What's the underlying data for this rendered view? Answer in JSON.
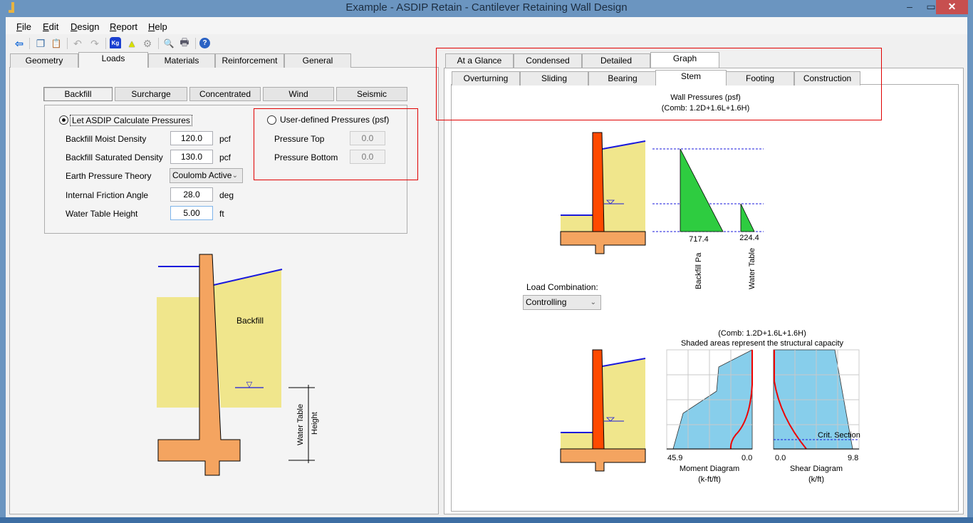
{
  "window": {
    "title": "Example - ASDIP Retain - Cantilever Retaining Wall Design",
    "minimize_glyph": "‒",
    "maximize_glyph": "▭",
    "close_glyph": "✕"
  },
  "menu": [
    {
      "label": "File",
      "accel": "F"
    },
    {
      "label": "Edit",
      "accel": "E"
    },
    {
      "label": "Design",
      "accel": "D"
    },
    {
      "label": "Report",
      "accel": "R"
    },
    {
      "label": "Help",
      "accel": "H"
    }
  ],
  "toolbar": [
    {
      "name": "pm-back-icon",
      "glyph": "⇦"
    },
    {
      "name": "copy-icon",
      "glyph": "❐"
    },
    {
      "name": "paste-icon",
      "glyph": "📋"
    },
    {
      "name": "undo-icon",
      "glyph": "↶"
    },
    {
      "name": "redo-icon",
      "glyph": "↷"
    },
    {
      "name": "weight-kg-icon",
      "glyph": "Kg"
    },
    {
      "name": "stack-icon",
      "glyph": "▲"
    },
    {
      "name": "gear-icon",
      "glyph": "⚙"
    },
    {
      "name": "zoom-icon",
      "glyph": "🔍"
    },
    {
      "name": "print-icon",
      "glyph": "🖶"
    },
    {
      "name": "help-icon",
      "glyph": "?"
    }
  ],
  "left_tabs": [
    "Geometry",
    "Loads",
    "Materials",
    "Reinforcement",
    "General"
  ],
  "left_active_tab": "Loads",
  "loads_subtabs": [
    "Backfill",
    "Surcharge",
    "Concentrated",
    "Wind",
    "Seismic"
  ],
  "loads_active_subtab": "Backfill",
  "backfill": {
    "calc_option_label": "Let ASDIP Calculate Pressures",
    "calc_option_selected": true,
    "user_option_label": "User-defined Pressures (psf)",
    "user_option_selected": false,
    "fields": [
      {
        "label": "Backfill Moist Density",
        "value": "120.0",
        "unit": "pcf"
      },
      {
        "label": "Backfill Saturated Density",
        "value": "130.0",
        "unit": "pcf"
      },
      {
        "label": "Earth Pressure Theory",
        "value": "Coulomb Active",
        "unit": ""
      },
      {
        "label": "Internal Friction Angle",
        "value": "28.0",
        "unit": "deg"
      },
      {
        "label": "Water Table Height",
        "value": "5.00",
        "unit": "ft"
      }
    ],
    "user_fields": [
      {
        "label": "Pressure Top",
        "value": "0.0"
      },
      {
        "label": "Pressure Bottom",
        "value": "0.0"
      }
    ]
  },
  "left_diagram": {
    "backfill_label": "Backfill",
    "dim_label_1": "Water Table",
    "dim_label_2": "Height",
    "water_symbol": "▽"
  },
  "right_tabs": [
    "At a Glance",
    "Condensed",
    "Detailed",
    "Graph"
  ],
  "right_active_tab": "Graph",
  "graph_subtabs": [
    "Overturning",
    "Sliding",
    "Bearing",
    "Stem",
    "Footing",
    "Construction"
  ],
  "graph_active_subtab": "Stem",
  "pressures": {
    "title": "Wall Pressures (psf)",
    "comb": "(Comb: 1.2D+1.6L+1.6H)",
    "backfill_value": "717.4",
    "water_value": "224.4",
    "backfill_label": "Backfill Pa",
    "water_label": "Water Table"
  },
  "load_combination": {
    "label": "Load Combination:",
    "value": "Controlling"
  },
  "capacity": {
    "comb": "(Comb: 1.2D+1.6L+1.6H)",
    "subtitle": "Shaded areas represent the structural capacity",
    "moment_left": "45.9",
    "moment_right": "0.0",
    "moment_title": "Moment Diagram",
    "moment_units": "(k-ft/ft)",
    "shear_left": "0.0",
    "shear_right": "9.8",
    "shear_title": "Shear Diagram",
    "shear_units": "(k/ft)",
    "crit_label": "Crit. Section"
  }
}
